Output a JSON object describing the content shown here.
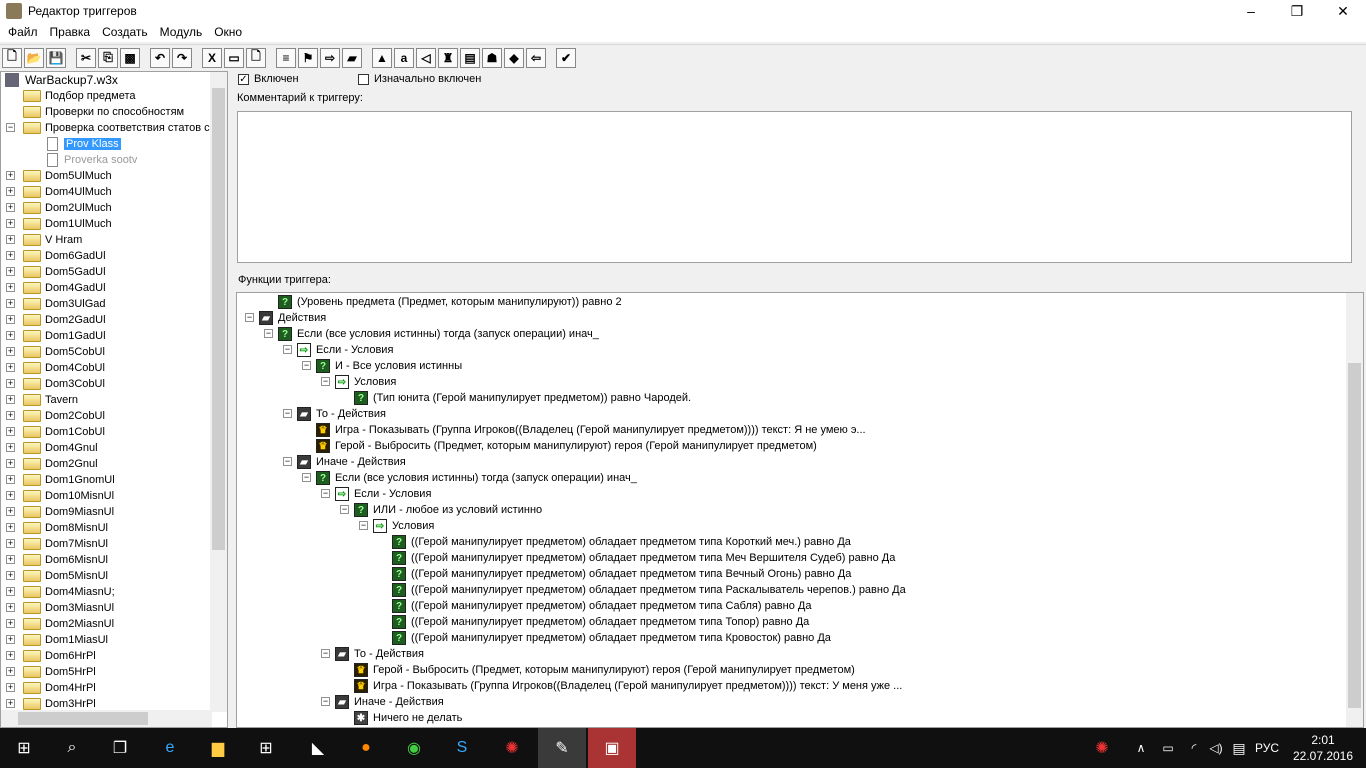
{
  "window": {
    "title": "Редактор триггеров",
    "minimize": "–",
    "maximize": "❐",
    "close": "✕"
  },
  "menu": [
    "Файл",
    "Правка",
    "Создать",
    "Модуль",
    "Окно"
  ],
  "toolbar": [
    "new",
    "open",
    "save",
    "cut",
    "copy",
    "paste",
    "undo",
    "redo",
    "x",
    "folder",
    "trigger",
    "comment",
    "flag",
    "import",
    "action",
    "terrain",
    "a",
    "sound",
    "unit",
    "object",
    "trigger-green",
    "doodad",
    "export",
    "test"
  ],
  "left_tree": {
    "root": "WarBackup7.w3x",
    "items": [
      {
        "l": "Подбор предмета",
        "lvl": 1,
        "t": "folder",
        "e": ""
      },
      {
        "l": "Проверки по способностям",
        "lvl": 1,
        "t": "folder",
        "e": ""
      },
      {
        "l": "Проверка соответствия статов с",
        "lvl": 1,
        "t": "folder",
        "e": "−"
      },
      {
        "l": "Prov Klass",
        "lvl": 2,
        "t": "doc",
        "sel": true
      },
      {
        "l": "Proverka sootv",
        "lvl": 2,
        "t": "doc",
        "dis": true
      },
      {
        "l": "Dom5UlMuch",
        "lvl": 1,
        "t": "folder",
        "e": "+"
      },
      {
        "l": "Dom4UlMuch",
        "lvl": 1,
        "t": "folder",
        "e": "+"
      },
      {
        "l": "Dom2UlMuch",
        "lvl": 1,
        "t": "folder",
        "e": "+"
      },
      {
        "l": "Dom1UlMuch",
        "lvl": 1,
        "t": "folder",
        "e": "+"
      },
      {
        "l": "V Hram",
        "lvl": 1,
        "t": "folder",
        "e": "+"
      },
      {
        "l": "Dom6GadUl",
        "lvl": 1,
        "t": "folder",
        "e": "+"
      },
      {
        "l": "Dom5GadUl",
        "lvl": 1,
        "t": "folder",
        "e": "+"
      },
      {
        "l": "Dom4GadUl",
        "lvl": 1,
        "t": "folder",
        "e": "+"
      },
      {
        "l": "Dom3UlGad",
        "lvl": 1,
        "t": "folder",
        "e": "+"
      },
      {
        "l": "Dom2GadUl",
        "lvl": 1,
        "t": "folder",
        "e": "+"
      },
      {
        "l": "Dom1GadUl",
        "lvl": 1,
        "t": "folder",
        "e": "+"
      },
      {
        "l": "Dom5CobUl",
        "lvl": 1,
        "t": "folder",
        "e": "+"
      },
      {
        "l": "Dom4CobUl",
        "lvl": 1,
        "t": "folder",
        "e": "+"
      },
      {
        "l": "Dom3CobUl",
        "lvl": 1,
        "t": "folder",
        "e": "+"
      },
      {
        "l": "Tavern",
        "lvl": 1,
        "t": "folder",
        "e": "+"
      },
      {
        "l": "Dom2CobUl",
        "lvl": 1,
        "t": "folder",
        "e": "+"
      },
      {
        "l": "Dom1CobUl",
        "lvl": 1,
        "t": "folder",
        "e": "+"
      },
      {
        "l": "Dom4Gnul",
        "lvl": 1,
        "t": "folder",
        "e": "+"
      },
      {
        "l": "Dom2Gnul",
        "lvl": 1,
        "t": "folder",
        "e": "+"
      },
      {
        "l": "Dom1GnomUl",
        "lvl": 1,
        "t": "folder",
        "e": "+"
      },
      {
        "l": "Dom10MisnUl",
        "lvl": 1,
        "t": "folder",
        "e": "+"
      },
      {
        "l": "Dom9MiasnUl",
        "lvl": 1,
        "t": "folder",
        "e": "+"
      },
      {
        "l": "Dom8MisnUl",
        "lvl": 1,
        "t": "folder",
        "e": "+"
      },
      {
        "l": "Dom7MisnUl",
        "lvl": 1,
        "t": "folder",
        "e": "+"
      },
      {
        "l": "Dom6MisnUl",
        "lvl": 1,
        "t": "folder",
        "e": "+"
      },
      {
        "l": "Dom5MisnUl",
        "lvl": 1,
        "t": "folder",
        "e": "+"
      },
      {
        "l": "Dom4MiasnU;",
        "lvl": 1,
        "t": "folder",
        "e": "+"
      },
      {
        "l": "Dom3MiasnUl",
        "lvl": 1,
        "t": "folder",
        "e": "+"
      },
      {
        "l": "Dom2MiasnUl",
        "lvl": 1,
        "t": "folder",
        "e": "+"
      },
      {
        "l": "Dom1MiasUl",
        "lvl": 1,
        "t": "folder",
        "e": "+"
      },
      {
        "l": "Dom6HrPl",
        "lvl": 1,
        "t": "folder",
        "e": "+"
      },
      {
        "l": "Dom5HrPl",
        "lvl": 1,
        "t": "folder",
        "e": "+"
      },
      {
        "l": "Dom4HrPl",
        "lvl": 1,
        "t": "folder",
        "e": "+"
      },
      {
        "l": "Dom3HrPl",
        "lvl": 1,
        "t": "folder",
        "e": "+"
      }
    ]
  },
  "trigger": {
    "enabled_label": "Включен",
    "enabled": true,
    "initially_on_label": "Изначально включен",
    "initially_on": false,
    "comment_label": "Комментарий к триггеру:",
    "comment": "",
    "functions_label": "Функции триггера:"
  },
  "functions": [
    {
      "l": "(Уровень предмета (Предмет, которым манипулируют)) равно 2",
      "lvl": 1,
      "t": "cond",
      "e": ""
    },
    {
      "l": "Действия",
      "lvl": 0,
      "t": "act",
      "e": "−"
    },
    {
      "l": "Если (все условия истинны) тогда (запуск операции) инач_",
      "lvl": 1,
      "t": "cond",
      "e": "−"
    },
    {
      "l": "Если - Условия",
      "lvl": 2,
      "t": "sub",
      "e": "−"
    },
    {
      "l": "И - Все условия истинны",
      "lvl": 3,
      "t": "cond",
      "e": "−"
    },
    {
      "l": "Условия",
      "lvl": 4,
      "t": "sub",
      "e": "−"
    },
    {
      "l": "(Тип юнита (Герой манипулирует предметом)) равно Чародей.",
      "lvl": 5,
      "t": "cond",
      "e": ""
    },
    {
      "l": "То - Действия",
      "lvl": 2,
      "t": "act",
      "e": "−"
    },
    {
      "l": "Игра - Показывать (Группа Игроков((Владелец (Герой манипулирует предметом)))) текст: Я не умею э...",
      "lvl": 3,
      "t": "hero",
      "e": ""
    },
    {
      "l": "Герой - Выбросить (Предмет, которым манипулируют) героя (Герой манипулирует предметом)",
      "lvl": 3,
      "t": "hero",
      "e": ""
    },
    {
      "l": "Иначе - Действия",
      "lvl": 2,
      "t": "act",
      "e": "−"
    },
    {
      "l": "Если (все условия истинны) тогда (запуск операции) инач_",
      "lvl": 3,
      "t": "cond",
      "e": "−"
    },
    {
      "l": "Если - Условия",
      "lvl": 4,
      "t": "sub",
      "e": "−"
    },
    {
      "l": "ИЛИ - любое из условий истинно",
      "lvl": 5,
      "t": "cond",
      "e": "−"
    },
    {
      "l": "Условия",
      "lvl": 6,
      "t": "sub",
      "e": "−"
    },
    {
      "l": "((Герой манипулирует предметом) обладает предметом типа Короткий меч.) равно Да",
      "lvl": 7,
      "t": "cond",
      "e": ""
    },
    {
      "l": "((Герой манипулирует предметом) обладает предметом типа Меч Вершителя Судеб) равно Да",
      "lvl": 7,
      "t": "cond",
      "e": ""
    },
    {
      "l": "((Герой манипулирует предметом) обладает предметом типа Вечный Огонь) равно Да",
      "lvl": 7,
      "t": "cond",
      "e": ""
    },
    {
      "l": "((Герой манипулирует предметом) обладает предметом типа Раскалыватель черепов.) равно Да",
      "lvl": 7,
      "t": "cond",
      "e": ""
    },
    {
      "l": "((Герой манипулирует предметом) обладает предметом типа Сабля) равно Да",
      "lvl": 7,
      "t": "cond",
      "e": ""
    },
    {
      "l": "((Герой манипулирует предметом) обладает предметом типа Топор) равно Да",
      "lvl": 7,
      "t": "cond",
      "e": ""
    },
    {
      "l": "((Герой манипулирует предметом) обладает предметом типа Кровосток) равно Да",
      "lvl": 7,
      "t": "cond",
      "e": ""
    },
    {
      "l": "То - Действия",
      "lvl": 4,
      "t": "act",
      "e": "−"
    },
    {
      "l": "Герой - Выбросить (Предмет, которым манипулируют) героя (Герой манипулирует предметом)",
      "lvl": 5,
      "t": "hero",
      "e": ""
    },
    {
      "l": "Игра - Показывать (Группа Игроков((Владелец (Герой манипулирует предметом)))) текст: У меня уже ...",
      "lvl": 5,
      "t": "hero",
      "e": ""
    },
    {
      "l": "Иначе - Действия",
      "lvl": 4,
      "t": "act",
      "e": "−"
    },
    {
      "l": "Ничего не делать",
      "lvl": 5,
      "t": "none",
      "e": ""
    }
  ],
  "taskbar": {
    "lang": "РУС",
    "time": "2:01",
    "date": "22.07.2016"
  }
}
